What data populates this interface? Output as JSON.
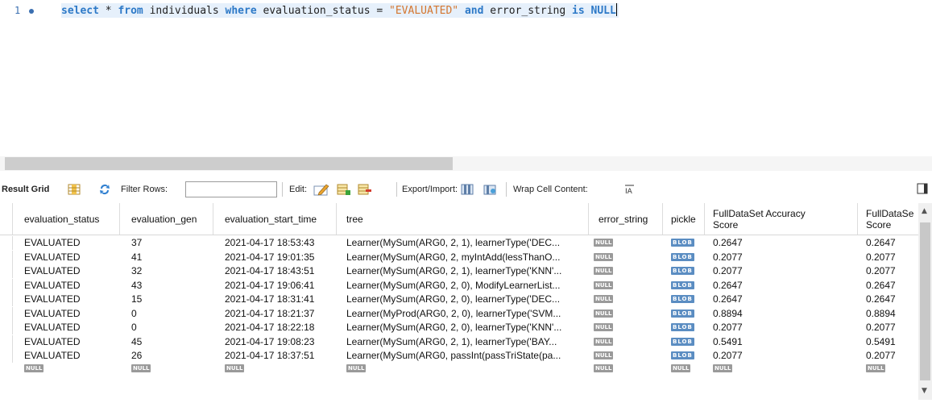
{
  "editor": {
    "line_number": "1",
    "sql": {
      "t1": "select",
      "t2": " * ",
      "t3": "from",
      "t4": " individuals ",
      "t5": "where",
      "t6": " evaluation_status = ",
      "t7": "\"EVALUATED\"",
      "t8": " ",
      "t9": "and",
      "t10": " error_string ",
      "t11": "is",
      "t12": " ",
      "t13": "NULL"
    }
  },
  "toolbar": {
    "result_grid": "Result Grid",
    "filter_rows": "Filter Rows:",
    "filter_value": "",
    "edit": "Edit:",
    "export_import": "Export/Import:",
    "wrap_cell": "Wrap Cell Content:"
  },
  "columns": [
    "evaluation_status",
    "evaluation_gen",
    "evaluation_start_time",
    "tree",
    "error_string",
    "pickle",
    "FullDataSet Accuracy Score",
    "FullDataSe Score"
  ],
  "rows": [
    {
      "status": "EVALUATED",
      "gen": "37",
      "start": "2021-04-17 18:53:43",
      "tree": "Learner(MySum(ARG0, 2, 1), learnerType('DEC...",
      "err": "NULL",
      "pickle": "BLOB",
      "acc": "0.2647",
      "acc2": "0.2647"
    },
    {
      "status": "EVALUATED",
      "gen": "41",
      "start": "2021-04-17 19:01:35",
      "tree": "Learner(MySum(ARG0, 2, myIntAdd(lessThanO...",
      "err": "NULL",
      "pickle": "BLOB",
      "acc": "0.2077",
      "acc2": "0.2077"
    },
    {
      "status": "EVALUATED",
      "gen": "32",
      "start": "2021-04-17 18:43:51",
      "tree": "Learner(MySum(ARG0, 2, 1), learnerType('KNN'...",
      "err": "NULL",
      "pickle": "BLOB",
      "acc": "0.2077",
      "acc2": "0.2077"
    },
    {
      "status": "EVALUATED",
      "gen": "43",
      "start": "2021-04-17 19:06:41",
      "tree": "Learner(MySum(ARG0, 2, 0), ModifyLearnerList...",
      "err": "NULL",
      "pickle": "BLOB",
      "acc": "0.2647",
      "acc2": "0.2647"
    },
    {
      "status": "EVALUATED",
      "gen": "15",
      "start": "2021-04-17 18:31:41",
      "tree": "Learner(MySum(ARG0, 2, 0), learnerType('DEC...",
      "err": "NULL",
      "pickle": "BLOB",
      "acc": "0.2647",
      "acc2": "0.2647"
    },
    {
      "status": "EVALUATED",
      "gen": "0",
      "start": "2021-04-17 18:21:37",
      "tree": "Learner(MyProd(ARG0, 2, 0), learnerType('SVM...",
      "err": "NULL",
      "pickle": "BLOB",
      "acc": "0.8894",
      "acc2": "0.8894"
    },
    {
      "status": "EVALUATED",
      "gen": "0",
      "start": "2021-04-17 18:22:18",
      "tree": "Learner(MySum(ARG0, 2, 0), learnerType('KNN'...",
      "err": "NULL",
      "pickle": "BLOB",
      "acc": "0.2077",
      "acc2": "0.2077"
    },
    {
      "status": "EVALUATED",
      "gen": "45",
      "start": "2021-04-17 19:08:23",
      "tree": "Learner(MySum(ARG0, 2, 1), learnerType('BAY...",
      "err": "NULL",
      "pickle": "BLOB",
      "acc": "0.5491",
      "acc2": "0.5491"
    },
    {
      "status": "EVALUATED",
      "gen": "26",
      "start": "2021-04-17 18:37:51",
      "tree": "Learner(MySum(ARG0, passInt(passTriState(pa...",
      "err": "NULL",
      "pickle": "BLOB",
      "acc": "0.2077",
      "acc2": "0.2077"
    }
  ],
  "new_row": [
    "NULL",
    "NULL",
    "NULL",
    "NULL",
    "NULL",
    "NULL",
    "NULL",
    "NULL"
  ],
  "colors": {
    "keyword": "#2d79c7",
    "string": "#d4762f",
    "blob": "#5b8dc2",
    "null": "#9a9a9a"
  }
}
